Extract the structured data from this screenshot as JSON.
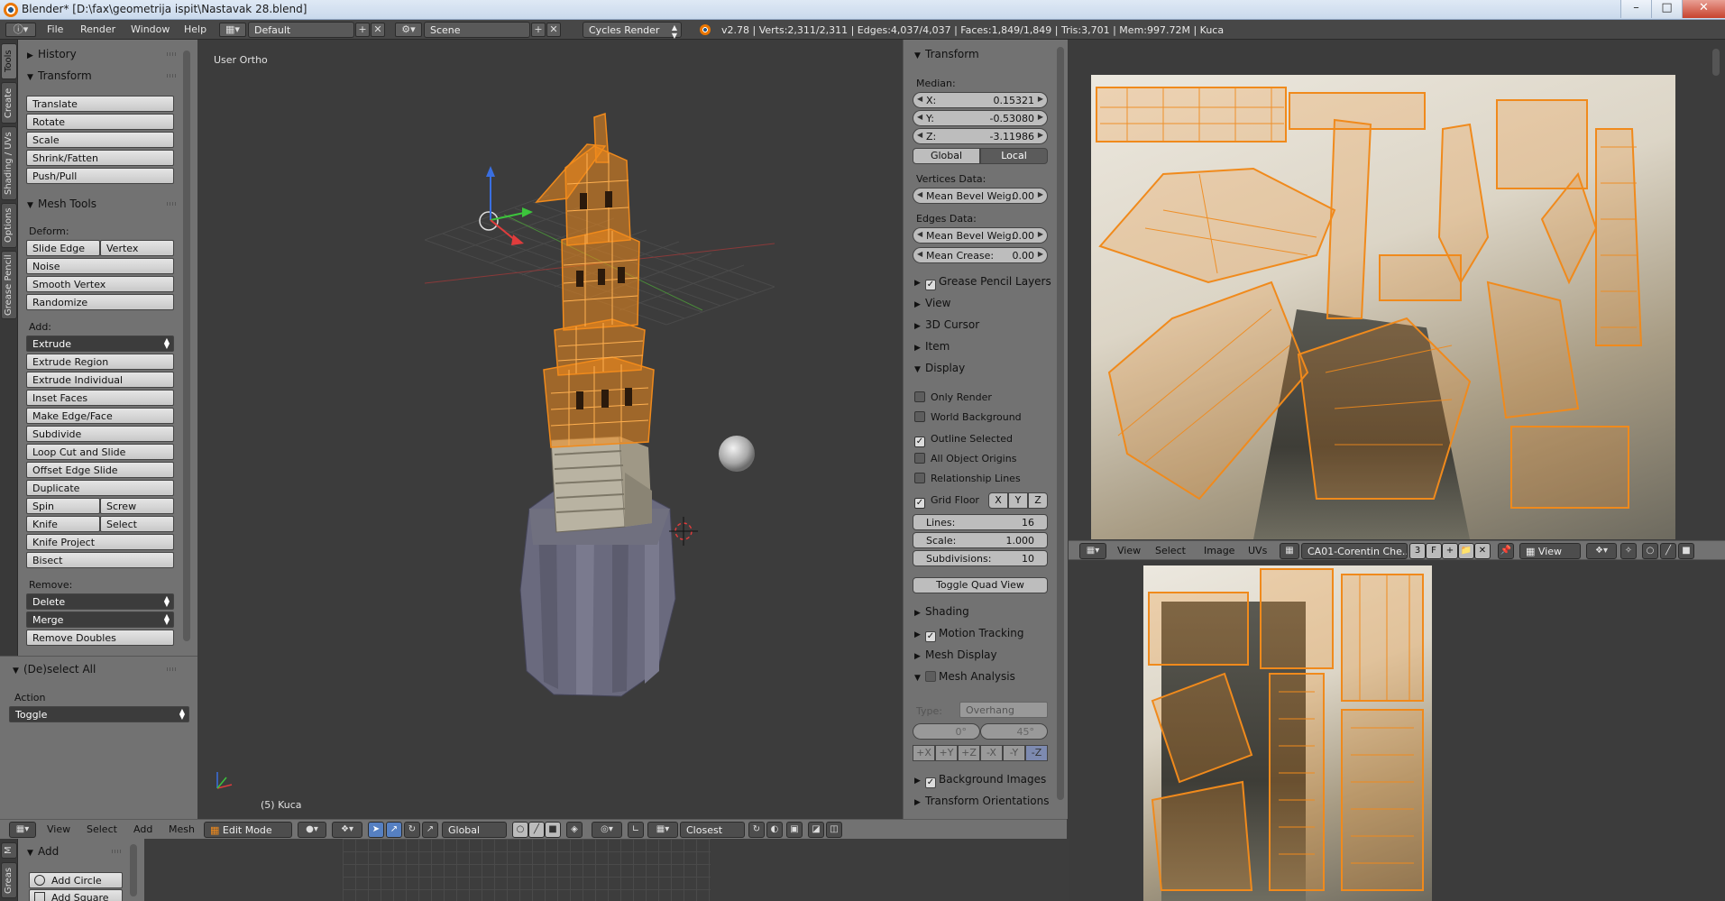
{
  "window": {
    "title": "Blender* [D:\\fax\\geometrija ispit\\Nastavak 28.blend]",
    "controls": [
      "–",
      "□",
      "✕"
    ]
  },
  "infobar": {
    "menus": [
      "File",
      "Render",
      "Window",
      "Help"
    ],
    "layout": "Default",
    "scene": "Scene",
    "engine": "Cycles Render",
    "stats": "v2.78 | Verts:2,311/2,311 | Edges:4,037/4,037 | Faces:1,849/1,849 | Tris:3,701 | Mem:997.72M | Kuca"
  },
  "tool_tabs": [
    "Tools",
    "Create",
    "Shading / UVs",
    "Options",
    "Grease Pencil"
  ],
  "tool_shelf": {
    "history": "History",
    "transform": {
      "header": "Transform",
      "buttons": [
        "Translate",
        "Rotate",
        "Scale",
        "Shrink/Fatten",
        "Push/Pull"
      ]
    },
    "mesh_tools": {
      "header": "Mesh Tools",
      "deform_label": "Deform:",
      "slide_edge": "Slide Edge",
      "vertex": "Vertex",
      "noise": "Noise",
      "smooth_vertex": "Smooth Vertex",
      "randomize": "Randomize",
      "add_label": "Add:",
      "extrude": "Extrude",
      "extrude_region": "Extrude Region",
      "extrude_individual": "Extrude Individual",
      "inset_faces": "Inset Faces",
      "make_edge_face": "Make Edge/Face",
      "subdivide": "Subdivide",
      "loop_cut": "Loop Cut and Slide",
      "offset_edge": "Offset Edge Slide",
      "duplicate": "Duplicate",
      "spin": "Spin",
      "screw": "Screw",
      "knife": "Knife",
      "select": "Select",
      "knife_project": "Knife Project",
      "bisect": "Bisect",
      "remove_label": "Remove:",
      "delete": "Delete",
      "merge": "Merge",
      "remove_doubles": "Remove Doubles"
    }
  },
  "operator_panel": {
    "header": "(De)select All",
    "action_label": "Action",
    "action_value": "Toggle"
  },
  "viewport": {
    "view_label": "User Ortho",
    "object_label": "(5) Kuca"
  },
  "viewport_header": {
    "menus": [
      "View",
      "Select",
      "Add",
      "Mesh"
    ],
    "mode": "Edit Mode",
    "orientation": "Global",
    "snap": "Closest"
  },
  "properties": {
    "transform_header": "Transform",
    "median_label": "Median:",
    "x_label": "X:",
    "x_value": "0.15321",
    "y_label": "Y:",
    "y_value": "-0.53080",
    "z_label": "Z:",
    "z_value": "-3.11986",
    "global": "Global",
    "local": "Local",
    "vertices_data": "Vertices Data:",
    "mean_bevel_label": "Mean Bevel Weig:",
    "mean_bevel_v": "0.00",
    "edges_data": "Edges Data:",
    "mean_bevel_e": "0.00",
    "mean_crease_label": "Mean Crease:",
    "mean_crease": "0.00",
    "grease_pencil_layers": "Grease Pencil Layers",
    "view": "View",
    "cursor_3d": "3D Cursor",
    "item": "Item",
    "display": "Display",
    "only_render": "Only Render",
    "world_background": "World Background",
    "outline_selected": "Outline Selected",
    "all_object_origins": "All Object Origins",
    "relationship_lines": "Relationship Lines",
    "grid_floor": "Grid Floor",
    "axis_x": "X",
    "axis_y": "Y",
    "axis_z": "Z",
    "lines_label": "Lines:",
    "lines_value": "16",
    "scale_label": "Scale:",
    "scale_value": "1.000",
    "subdiv_label": "Subdivisions:",
    "subdiv_value": "10",
    "toggle_quad": "Toggle Quad View",
    "shading": "Shading",
    "motion_tracking": "Motion Tracking",
    "mesh_display": "Mesh Display",
    "mesh_analysis": "Mesh Analysis",
    "type_label": "Type:",
    "type_value": "Overhang",
    "angle_min": "0°",
    "angle_max": "45°",
    "axes": [
      "+X",
      "+Y",
      "+Z",
      "-X",
      "-Y",
      "-Z"
    ],
    "background_images": "Background Images",
    "transform_orientations": "Transform Orientations"
  },
  "uv_header": {
    "menus": [
      "View",
      "Select",
      "Image",
      "UVs"
    ],
    "image_name": "CA01-Corentin Che...",
    "users": "3",
    "fake": "F",
    "view_menu": "View"
  },
  "bottom_editor": {
    "tabs": [
      "M",
      "Greas"
    ],
    "add_header": "Add",
    "add_circle": "Add Circle",
    "add_square": "Add Square"
  },
  "colors": {
    "accent_orange": "#f08a1c",
    "panel_gray": "#727272",
    "viewport_bg": "#3c3c3c",
    "active_blue": "#5680c2"
  }
}
